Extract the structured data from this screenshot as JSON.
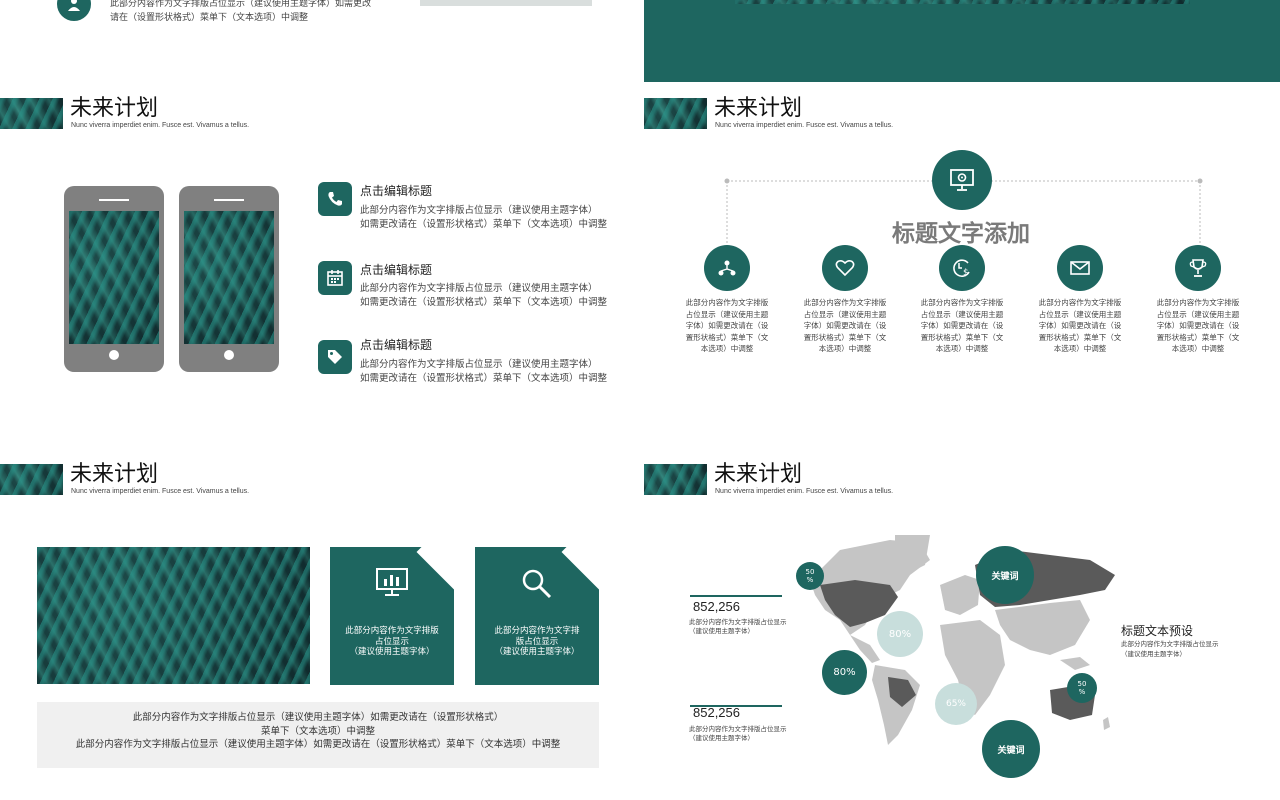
{
  "colors": {
    "accent": "#1e6660",
    "gray": "#808080",
    "light_teal": "#c8dedc",
    "map_gray": "#c5c5c5",
    "map_dark": "#5a5a5a"
  },
  "top_left": {
    "text_line1": "此部分内容作为文字排版占位显示（建议使用主题字体）如需更改",
    "text_line2": "请在（设置形状格式）菜单下（文本选项）中调整",
    "icon": "user-icon"
  },
  "slide_common": {
    "title": "未来计划",
    "subtitle": "Nunc viverra imperdiet  enim. Fusce est. Vivamus  a tellus."
  },
  "slide_phones": {
    "features": [
      {
        "icon": "phone-icon",
        "title": "点击编辑标题",
        "line1": "此部分内容作为文字排版占位显示（建议使用主题字体）",
        "line2": "如需更改请在（设置形状格式）菜单下（文本选项）中调整"
      },
      {
        "icon": "calendar-icon",
        "title": "点击编辑标题",
        "line1": "此部分内容作为文字排版占位显示（建议使用主题字体）",
        "line2": "如需更改请在（设置形状格式）菜单下（文本选项）中调整"
      },
      {
        "icon": "tag-icon",
        "title": "点击编辑标题",
        "line1": "此部分内容作为文字排版占位显示（建议使用主题字体）",
        "line2": "如需更改请在（设置形状格式）菜单下（文本选项）中调整"
      }
    ]
  },
  "slide_tree": {
    "heading": "标题文字添加",
    "top_icon": "monitor-gear-icon",
    "items": [
      {
        "icon": "network-icon",
        "lines": [
          "此部分内容作为文字排版",
          "占位显示（建议使用主题",
          "字体）如需更改请在（设",
          "置形状格式）菜单下（文",
          "本选项）中调整"
        ]
      },
      {
        "icon": "heart-icon",
        "lines": [
          "此部分内容作为文字排版",
          "占位显示（建议使用主题",
          "字体）如需更改请在（设",
          "置形状格式）菜单下（文",
          "本选项）中调整"
        ]
      },
      {
        "icon": "money-clock-icon",
        "lines": [
          "此部分内容作为文字排版",
          "占位显示（建议使用主题",
          "字体）如需更改请在（设",
          "置形状格式）菜单下（文",
          "本选项）中调整"
        ]
      },
      {
        "icon": "envelope-icon",
        "lines": [
          "此部分内容作为文字排版",
          "占位显示（建议使用主题",
          "字体）如需更改请在（设",
          "置形状格式）菜单下（文",
          "本选项）中调整"
        ]
      },
      {
        "icon": "trophy-icon",
        "lines": [
          "此部分内容作为文字排版",
          "占位显示（建议使用主题",
          "字体）如需更改请在（设",
          "置形状格式）菜单下（文",
          "本选项）中调整"
        ]
      }
    ]
  },
  "slide_cards": {
    "cards": [
      {
        "icon": "chart-board-icon",
        "lines": [
          "此部分内容作为文字排版",
          "占位显示",
          "（建议使用主题字体）"
        ]
      },
      {
        "icon": "search-icon",
        "lines": [
          "此部分内容作为文字排",
          "版占位显示",
          "（建议使用主题字体）"
        ]
      }
    ],
    "bottom_lines": [
      "此部分内容作为文字排版占位显示（建议使用主题字体）如需更改请在（设置形状格式）",
      "菜单下（文本选项）中调整",
      "此部分内容作为文字排版占位显示（建议使用主题字体）如需更改请在（设置形状格式）菜单下（文本选项）中调整"
    ]
  },
  "slide_map": {
    "stats": [
      {
        "value": "852,256",
        "line1": "此部分内容作为文字排版占位显示",
        "line2": "（建议使用主题字体）"
      },
      {
        "value": "852,256",
        "line1": "此部分内容作为文字排版占位显示",
        "line2": "（建议使用主题字体）"
      }
    ],
    "bubbles": [
      "50\n%",
      "80%",
      "80%",
      "65%",
      "50\n%"
    ],
    "keyword_1": "关键词",
    "keyword_2": "关键词",
    "side_title": "标题文本预设",
    "side_line1": "此部分内容作为文字排版占位显示",
    "side_line2": "（建议使用主题字体）"
  }
}
